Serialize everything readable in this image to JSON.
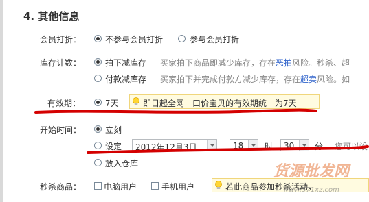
{
  "section": {
    "title": "4. 其他信息"
  },
  "member_discount": {
    "label": "会员打折：",
    "options": [
      "不参与会员打折",
      "参与会员打折"
    ],
    "selected": 0
  },
  "inventory": {
    "label": "库存计数：",
    "option1": {
      "label": "拍下减库存",
      "hint_prefix": "买家拍下商品即减少库存，存在",
      "hint_link": "恶拍",
      "hint_suffix": "风险。秒杀、超"
    },
    "option2": {
      "label": "付款减库存",
      "hint_prefix": "买家拍下并完成付款方减少库存，存在",
      "hint_link": "超卖",
      "hint_suffix": "风险。如"
    },
    "selected": 0
  },
  "validity": {
    "label": "有效期：",
    "option": "7天",
    "tip": "即日起全网一口价宝贝的有效期统一为7天"
  },
  "start_time": {
    "label": "开始时间：",
    "option_now": "立刻",
    "option_set": "设定",
    "date_value": "2012年12月3日",
    "hour_value": "18",
    "hour_unit": "时",
    "minute_value": "30",
    "minute_unit": "分",
    "hint": "您可以设",
    "option_warehouse": "放入仓库",
    "selected": 0
  },
  "flash_sale": {
    "label": "秒杀商品：",
    "options": [
      "电脑用户",
      "手机用户"
    ],
    "tip": "若此商品参加秒杀活动，"
  },
  "watermark": {
    "text1": "货源批发网",
    "text2": "www.571xz.com"
  },
  "colors": {
    "accent_red": "#d40000",
    "link_blue": "#3366cc",
    "tip_bg": "#fffbe0"
  }
}
